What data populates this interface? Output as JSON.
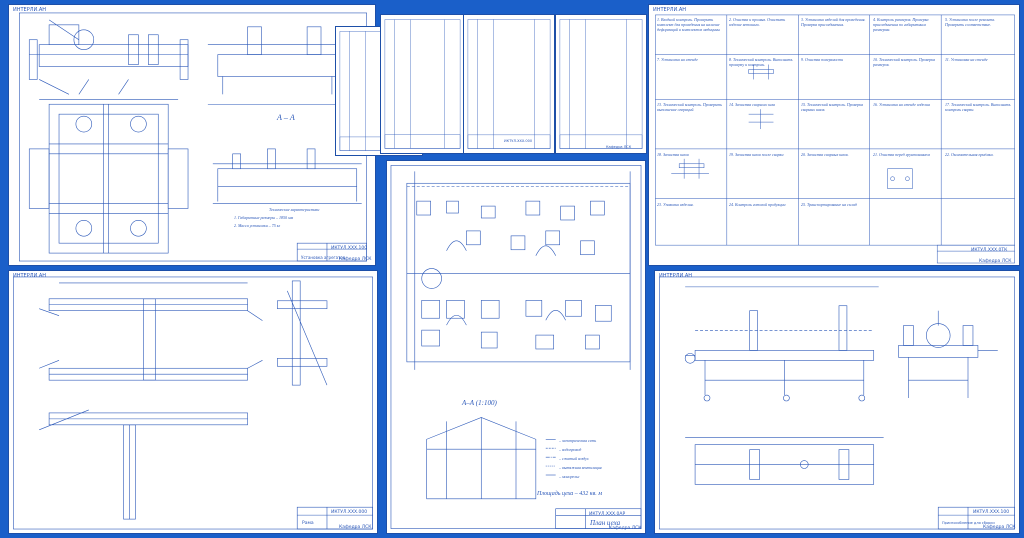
{
  "sheets": {
    "assembly_top_left": {
      "tag": "ИНТЕРЛИ.АН",
      "code": "ИКТУЛ.ХХХ.100",
      "title": "Установка агрегатов",
      "org": "Кафедра ЛСК",
      "section_label": "А – А",
      "notes": [
        "Технические характеристики",
        "1. Габаритные размеры – 1850 мм",
        "2. Масса установки – 75 кг"
      ]
    },
    "spec_sheets": {
      "code": "ИКТУЛ.ХХХ.000",
      "org": "Кафедра ЛСК"
    },
    "process_chart": {
      "tag": "ИНТЕРЛИ.АН",
      "code": "ИКТУЛ.ХХХ.0ТК",
      "org": "Кафедра ЛСК",
      "steps": [
        {
          "text": "1. Входной контроль. Проверить комплект для проведения на наличие деформаций и комплектов медицины"
        },
        {
          "text": "2. Очистка и промыв. Очистить изделие ветошью."
        },
        {
          "text": "3. Установка изделий для проведения. Проверка присоединения."
        },
        {
          "text": "4. Контроль размеров. Проверка присоединения по габаритным размерам."
        },
        {
          "text": "5. Установка после ремонта. Проверить соответствие."
        },
        {
          "text": "7. Установка на стенде"
        },
        {
          "text": "8. Технический контроль. Выполнить проверку и контроль."
        },
        {
          "text": "9. Очистка поверхности"
        },
        {
          "text": "10. Технический контроль. Проверка размеров."
        },
        {
          "text": "11. Установка на стенде"
        },
        {
          "text": "13. Технический контроль. Проверить выполнение операций."
        },
        {
          "text": "14. Зачистка сварного шва"
        },
        {
          "text": "15. Технический контроль. Проверка сварных швов."
        },
        {
          "text": "16. Установка на стенде изделия"
        },
        {
          "text": "17. Технический контроль. Выполнить контроль сварки."
        },
        {
          "text": "18. Зачистка швов"
        },
        {
          "text": "19. Зачистка швов после сварки"
        },
        {
          "text": "20. Зачистка сварных швов."
        },
        {
          "text": "21. Очистка перед грунтованием"
        },
        {
          "text": "22. Окончательная приёмка."
        },
        {
          "text": "23. Упаковка изделия."
        },
        {
          "text": "24. Контроль готовой продукции"
        },
        {
          "text": "25. Транспортирование на склад"
        }
      ]
    },
    "weld_frame": {
      "tag": "ИНТЕРЛИ.АН",
      "code": "ИКТУЛ.ХХХ.000",
      "title": "Рама",
      "org": "Кафедра ЛСК"
    },
    "shop_plan": {
      "code": "ИКТУЛ.ХХХ.0АР",
      "title": "План цеха",
      "org": "Кафедра ЛСК",
      "section_label": "А–А (1:100)",
      "area": "Площадь цеха – 432 кв. м",
      "legend": [
        "– электрическая сеть",
        "– водопровод",
        "– сжатый воздух",
        "– вытяжная вентиляция",
        "– монорельс"
      ]
    },
    "stand": {
      "tag": "ИНТЕРЛИ.АН",
      "code": "ИКТУЛ.ХХХ.100",
      "title": "Приспособление для сборки",
      "org": "Кафедра ЛСК"
    }
  }
}
